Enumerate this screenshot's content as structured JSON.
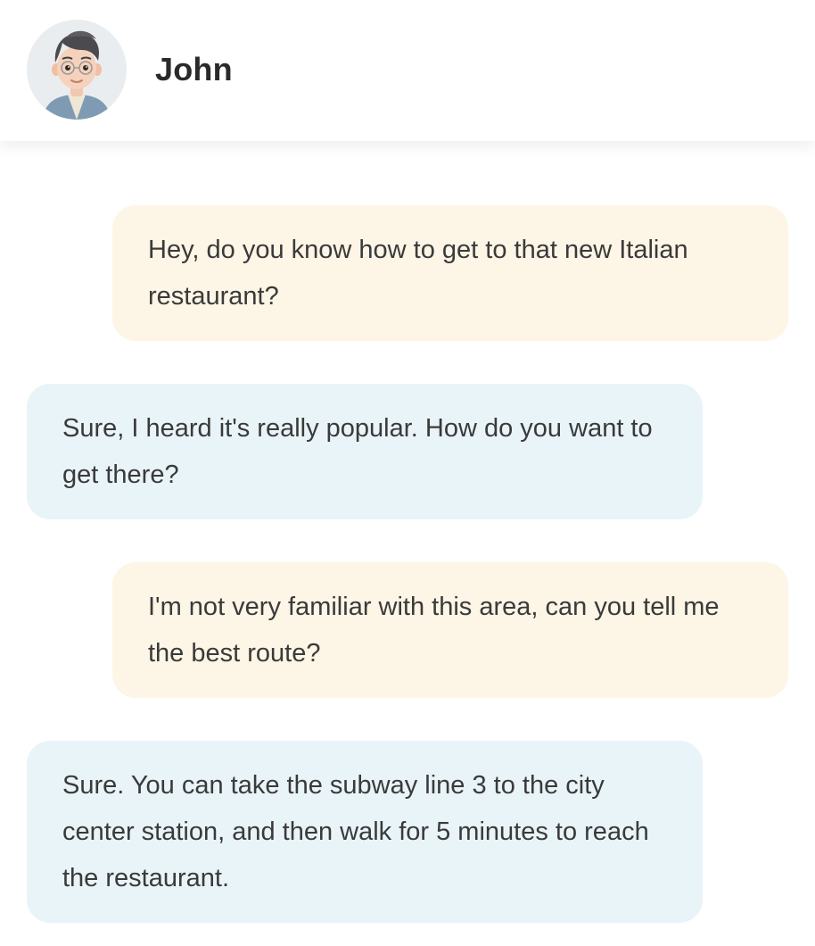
{
  "chat": {
    "contact_name": "John",
    "avatar_icon": "user-avatar-icon"
  },
  "messages": [
    {
      "sender": "me",
      "text": "Hey, do you know how to get to that new Italian restaurant?"
    },
    {
      "sender": "John",
      "text": "Sure, I heard it's really popular. How do you want to get there?"
    },
    {
      "sender": "me",
      "text": "I'm not very familiar with this area, can you tell me the best route?"
    },
    {
      "sender": "John",
      "text": "Sure. You can take the subway line 3 to the city center station, and then walk for 5 minutes to reach the restaurant."
    }
  ],
  "colors": {
    "sent_bubble": "#fdf5e6",
    "received_bubble": "#e9f4f9",
    "text": "#3a3a3a"
  }
}
